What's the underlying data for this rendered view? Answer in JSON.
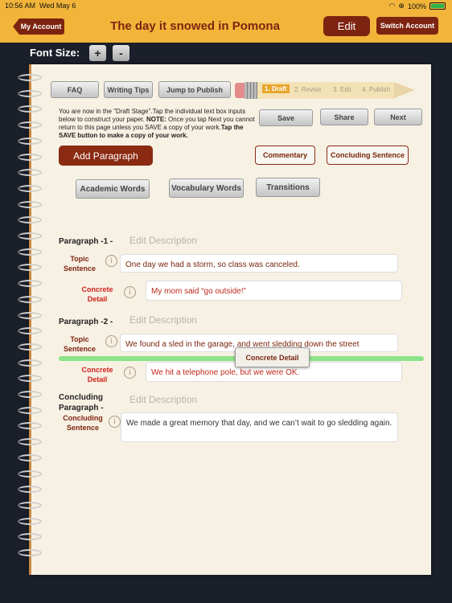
{
  "status_bar": {
    "time": "10:56 AM",
    "date": "Wed May 6",
    "battery": "100%"
  },
  "nav": {
    "back_label": "My Account",
    "title": "The day it snowed in Pomona",
    "edit_label": "Edit",
    "switch_label": "Switch Account"
  },
  "font_size": {
    "label": "Font Size:",
    "increase": "+",
    "decrease": "-"
  },
  "toolbar": {
    "faq": "FAQ",
    "writing_tips": "Writing Tips",
    "jump_to_publish": "Jump to Publish"
  },
  "stages": [
    "1. Draft",
    "2. Revise",
    "3. Edit",
    "4. Publish"
  ],
  "active_stage": "1. Draft",
  "info": {
    "text": "You are now in the \"Draft Stage\".Tap the individual text box inputs below to construct your paper. ",
    "note_label": "NOTE:",
    "note_text": " Once you tap Next you cannot return to this page unless you SAVE a copy of your work.",
    "save_tip": "Tap the SAVE button to make a copy of your work."
  },
  "actions": {
    "save": "Save",
    "share": "Share",
    "next": "Next"
  },
  "buttons": {
    "add_paragraph": "Add Paragraph",
    "commentary": "Commentary",
    "concluding_sentence": "Concluding Sentence",
    "academic_words": "Academic Words",
    "vocabulary_words": "Vocabulary Words",
    "transitions": "Transitions"
  },
  "edit_description": "Edit Description",
  "paragraphs": [
    {
      "title": "Paragraph -1  -",
      "topic_label": "Topic Sentence",
      "topic": "One day we had a storm, so class was canceled.",
      "detail_label": "Concrete Detail",
      "detail": "My mom said “go outside!”"
    },
    {
      "title": "Paragraph -2  -",
      "topic_label": "Topic Sentence",
      "topic": "We found a sled in the garage, and went sledding down the street",
      "detail_label": "Concrete Detail",
      "detail": "We hit a telephone pole, but we were OK."
    }
  ],
  "concluding": {
    "title": "Concluding Paragraph  -",
    "label": "Concluding Sentence",
    "text": "We made a great memory that day, and we can’t wait to go sledding again."
  },
  "drag_chip": "Concrete Detail",
  "colors": {
    "nav_bar": "#f2b53a",
    "accent": "#7d2410",
    "detail_red": "#d0201c",
    "drop_indicator": "#8be38a"
  }
}
